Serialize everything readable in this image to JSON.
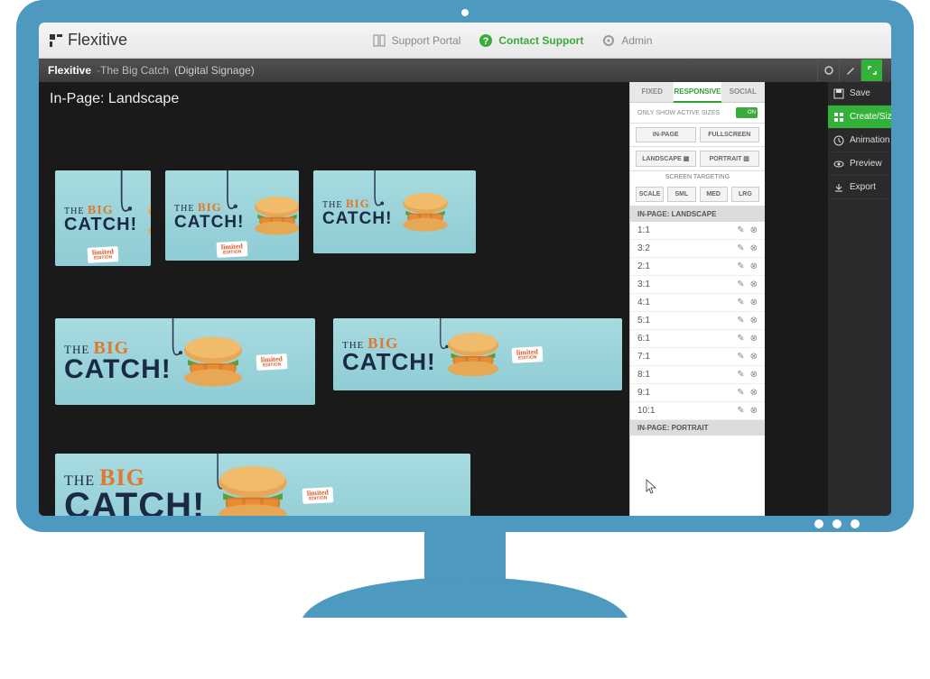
{
  "brand": "Flexitive",
  "top_links": {
    "portal": "Support Portal",
    "contact": "Contact Support",
    "admin": "Admin"
  },
  "breadcrumb": {
    "app": "Flexitive",
    "project": "The Big Catch",
    "context": "(Digital Signage)"
  },
  "section_title": "In-Page: Landscape",
  "rail": {
    "save": "Save",
    "create": "Create/Sizes",
    "animation": "Animation",
    "preview": "Preview",
    "export": "Export"
  },
  "panel": {
    "tabs": {
      "fixed": "FIXED",
      "responsive": "RESPONSIVE",
      "social": "SOCIAL"
    },
    "only_active": "ONLY SHOW ACTIVE SIZES",
    "toggle_state": "ON",
    "row1": {
      "inpage": "IN-PAGE",
      "fullscreen": "FULLSCREEN"
    },
    "row2": {
      "landscape": "LANDSCAPE",
      "portrait": "PORTRAIT"
    },
    "targeting": "SCREEN TARGETING",
    "row3": {
      "scale": "SCALE",
      "sml": "SML",
      "med": "MED",
      "lrg": "LRG"
    },
    "sections": {
      "landscape": {
        "title": "IN-PAGE: LANDSCAPE",
        "items": [
          "1:1",
          "3:2",
          "2:1",
          "3:1",
          "4:1",
          "5:1",
          "6:1",
          "7:1",
          "8:1",
          "9:1",
          "10:1"
        ]
      },
      "portrait": {
        "title": "IN-PAGE: PORTRAIT"
      }
    }
  },
  "ad_copy": {
    "the": "THE",
    "big": "BIG",
    "catch": "CATCH!",
    "limited": "limited",
    "edition": "EDITION"
  },
  "previews": [
    {
      "ratio": "1:1"
    },
    {
      "ratio": "3:2"
    },
    {
      "ratio": "2:1"
    },
    {
      "ratio": "3:1"
    },
    {
      "ratio": "4:1"
    },
    {
      "ratio": "5:1"
    }
  ]
}
